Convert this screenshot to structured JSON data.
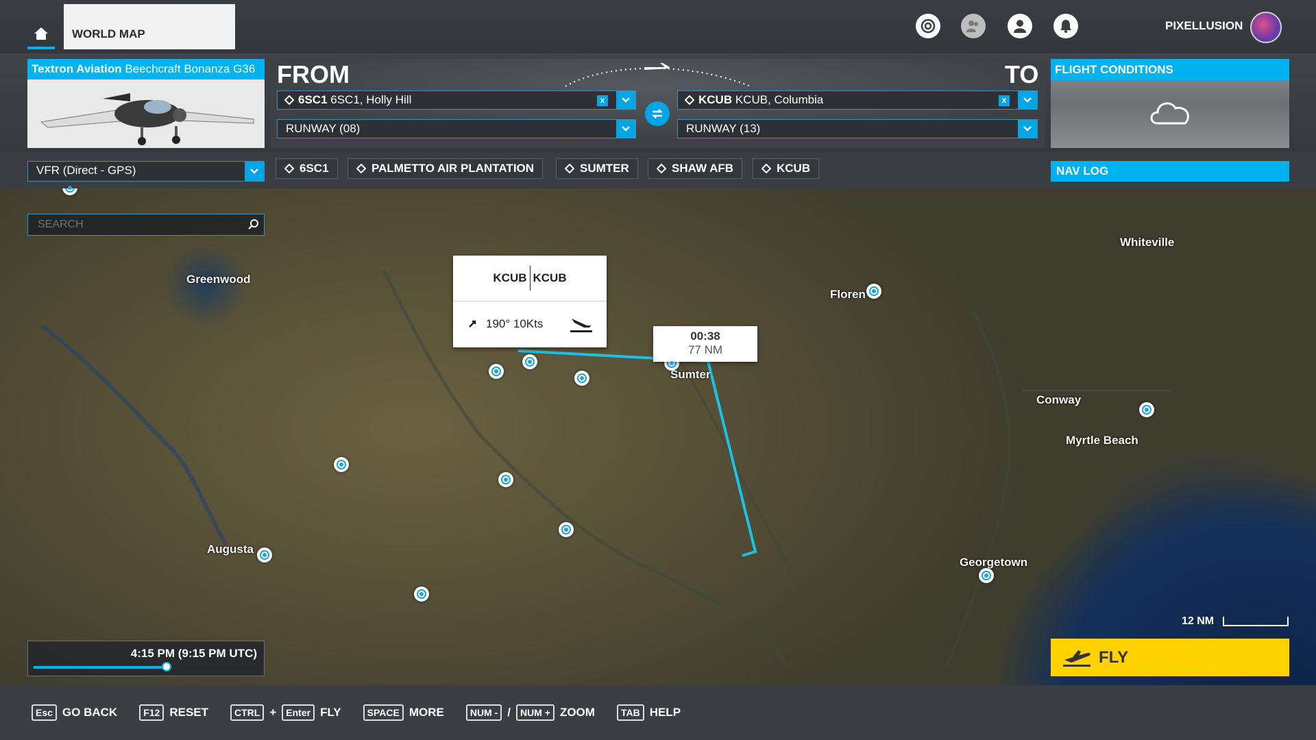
{
  "header": {
    "tab_title": "WORLD MAP",
    "username": "PIXELLUSION",
    "icons": [
      "home-icon",
      "news-icon",
      "friends-icon",
      "profile-icon",
      "notifications-icon",
      "avatar"
    ]
  },
  "aircraft": {
    "brand": "Textron Aviation",
    "model": "Beechcraft Bonanza G36"
  },
  "route": {
    "from_label": "FROM",
    "to_label": "TO",
    "departure": {
      "code": "6SC1",
      "name": "6SC1, Holly Hill",
      "runway": "RUNWAY (08)"
    },
    "arrival": {
      "code": "KCUB",
      "name": "KCUB, Columbia",
      "runway": "RUNWAY (13)"
    },
    "clear_symbol": "x"
  },
  "conditions": {
    "title": "FLIGHT CONDITIONS",
    "icon": "cloud-icon"
  },
  "flight_plan": {
    "type": "VFR (Direct - GPS)",
    "waypoints": [
      "6SC1",
      "PALMETTO AIR PLANTATION",
      "SUMTER",
      "SHAW AFB",
      "KCUB"
    ],
    "nav_log_label": "NAV LOG"
  },
  "search": {
    "placeholder": "SEARCH"
  },
  "map": {
    "cities": {
      "greenwood": "Greenwood",
      "augusta": "Augusta",
      "sumter": "Sumter",
      "florence": "Floren",
      "whiteville": "Whiteville",
      "conway": "Conway",
      "myrtle_beach": "Myrtle Beach",
      "georgetown": "Georgetown"
    },
    "airport_popup": {
      "code": "KCUB",
      "name": "KCUB",
      "wind": "190° 10Kts"
    },
    "leg_popup": {
      "time": "00:38",
      "distance": "77 NM"
    },
    "scale_label": "12 NM",
    "route_color": "#19c3e6"
  },
  "time": {
    "label": "4:15 PM (9:15 PM UTC)",
    "slider_fraction": 0.59
  },
  "fly_button": {
    "label": "FLY",
    "color": "#ffd200"
  },
  "footer": {
    "go_back": {
      "key": "Esc",
      "label": "GO BACK"
    },
    "reset": {
      "key": "F12",
      "label": "RESET"
    },
    "fly": {
      "key1": "CTRL",
      "plus": "+",
      "key2": "Enter",
      "label": "FLY"
    },
    "more": {
      "key": "SPACE",
      "label": "MORE"
    },
    "zoom": {
      "key1": "NUM -",
      "slash": "/",
      "key2": "NUM +",
      "label": "ZOOM"
    },
    "help": {
      "key": "TAB",
      "label": "HELP"
    }
  },
  "accent_color": "#00b3f0"
}
